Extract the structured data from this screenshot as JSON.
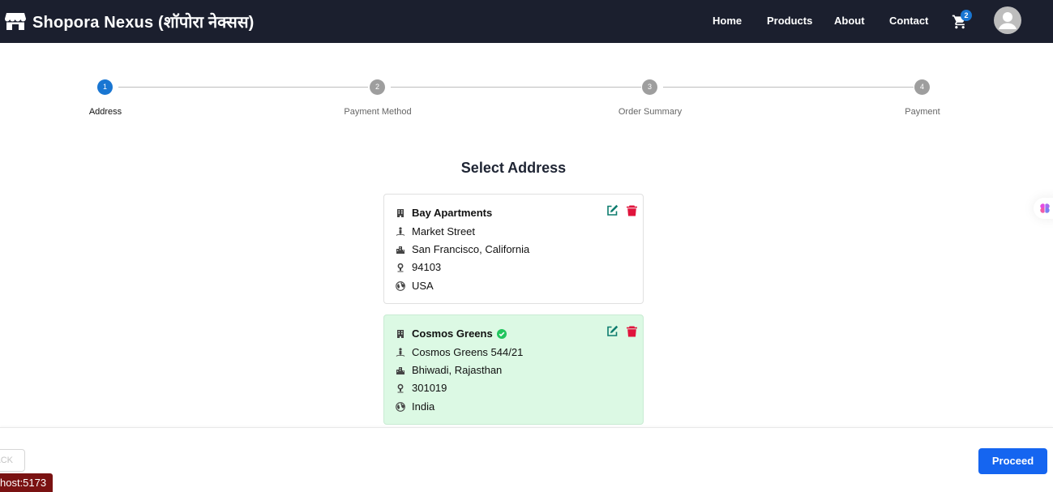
{
  "nav": {
    "brand": "Shopora Nexus (शॉपोरा नेक्सस)",
    "links": [
      "Home",
      "Products",
      "About",
      "Contact"
    ],
    "cart_count": "2"
  },
  "stepper": {
    "steps": [
      {
        "num": "1",
        "label": "Address"
      },
      {
        "num": "2",
        "label": "Payment Method"
      },
      {
        "num": "3",
        "label": "Order Summary"
      },
      {
        "num": "4",
        "label": "Payment"
      }
    ],
    "active_step": 1
  },
  "main": {
    "title": "Select Address",
    "addresses": [
      {
        "name": "Bay Apartments",
        "street": "Market Street",
        "city_state": "San Francisco, California",
        "zip": "94103",
        "country": "USA",
        "selected": false
      },
      {
        "name": "Cosmos Greens",
        "street": "Cosmos Greens 544/21",
        "city_state": "Bhiwadi, Rajasthan",
        "zip": "301019",
        "country": "India",
        "selected": true
      }
    ]
  },
  "footer": {
    "back_label": "ACK",
    "proceed_label": "Proceed",
    "host_label": "host:5173"
  },
  "icons": {
    "brand": "store-icon",
    "cart": "cart-icon",
    "avatar": "account-icon",
    "building": "building-icon",
    "street": "person-pin-icon",
    "city": "city-icon",
    "zip": "location-pin-icon",
    "country": "globe-icon",
    "edit": "edit-icon",
    "delete": "trash-icon",
    "check": "check-circle-icon",
    "ai": "brain-icon"
  },
  "colors": {
    "navbar": "#1b1f2e",
    "primary": "#1976d2",
    "proceed": "#1565f0",
    "selected_card": "#dcf9e4",
    "edit": "#0d7c6e",
    "delete": "#e0143c",
    "check": "#22c55e"
  }
}
